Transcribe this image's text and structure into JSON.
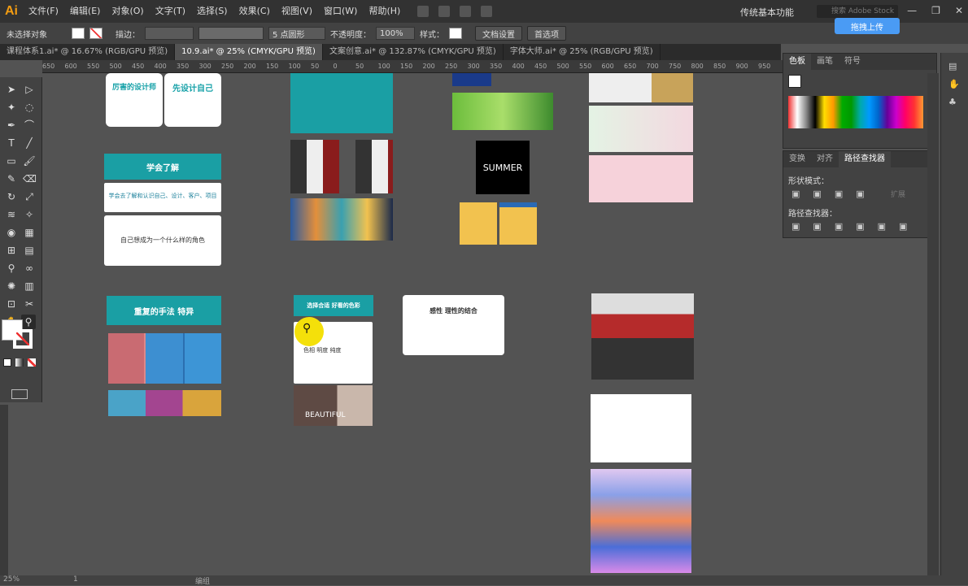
{
  "menubar": {
    "logo": "Ai",
    "items": [
      "文件(F)",
      "编辑(E)",
      "对象(O)",
      "文字(T)",
      "选择(S)",
      "效果(C)",
      "视图(V)",
      "窗口(W)",
      "帮助(H)"
    ],
    "workspace": "传统基本功能",
    "search_placeholder": "搜索 Adobe Stock"
  },
  "controlbar": {
    "selection": "未选择对象",
    "stroke_label": "描边：",
    "brush": "5 点圆形",
    "opacity_label": "不透明度：",
    "opacity_value": "100%",
    "style_label": "样式：",
    "doc_settings": "文档设置",
    "preferences": "首选项"
  },
  "upload_button": "拖拽上传",
  "tabs": [
    "课程体系1.ai* @ 16.67% (RGB/GPU 预览)",
    "10.9.ai* @ 25% (CMYK/GPU 预览)",
    "文案创意.ai* @ 132.87% (CMYK/GPU 预览)",
    "字体大师.ai* @ 25% (RGB/GPU 预览)"
  ],
  "ruler_ticks": [
    "650",
    "600",
    "550",
    "500",
    "450",
    "400",
    "350",
    "300",
    "250",
    "200",
    "150",
    "100",
    "50",
    "0",
    "50",
    "100",
    "150",
    "200",
    "250",
    "300",
    "350",
    "400",
    "450",
    "500",
    "550",
    "600",
    "650",
    "700",
    "750",
    "800",
    "850",
    "900",
    "950"
  ],
  "swatches_panel": {
    "tabs": [
      "色板",
      "画笔",
      "符号"
    ]
  },
  "pathfinder_panel": {
    "tabs": [
      "变换",
      "对齐",
      "路径查找器"
    ],
    "shape_modes": "形状模式：",
    "pathfinders": "路径查找器：",
    "expand": "扩展"
  },
  "artboards": {
    "card1_title": "厉害的设计师",
    "card2_title": "先设计自己",
    "learn_title": "学会了解",
    "learn_sub": "学会去了解和认识自己、设计、客户、项目",
    "role_text": "自己想成为一个什么样的角色",
    "repeat_title": "重复的手法 特异",
    "color_title": "选择合适 好看的色彩",
    "color_text": "色相 明度 纯度",
    "beautiful": "BEAUTIFUL",
    "summer": "SUMMER",
    "emotion": "感性 理性的结合"
  },
  "statusbar": {
    "zoom": "25%",
    "page": "1",
    "mode": "编组"
  }
}
